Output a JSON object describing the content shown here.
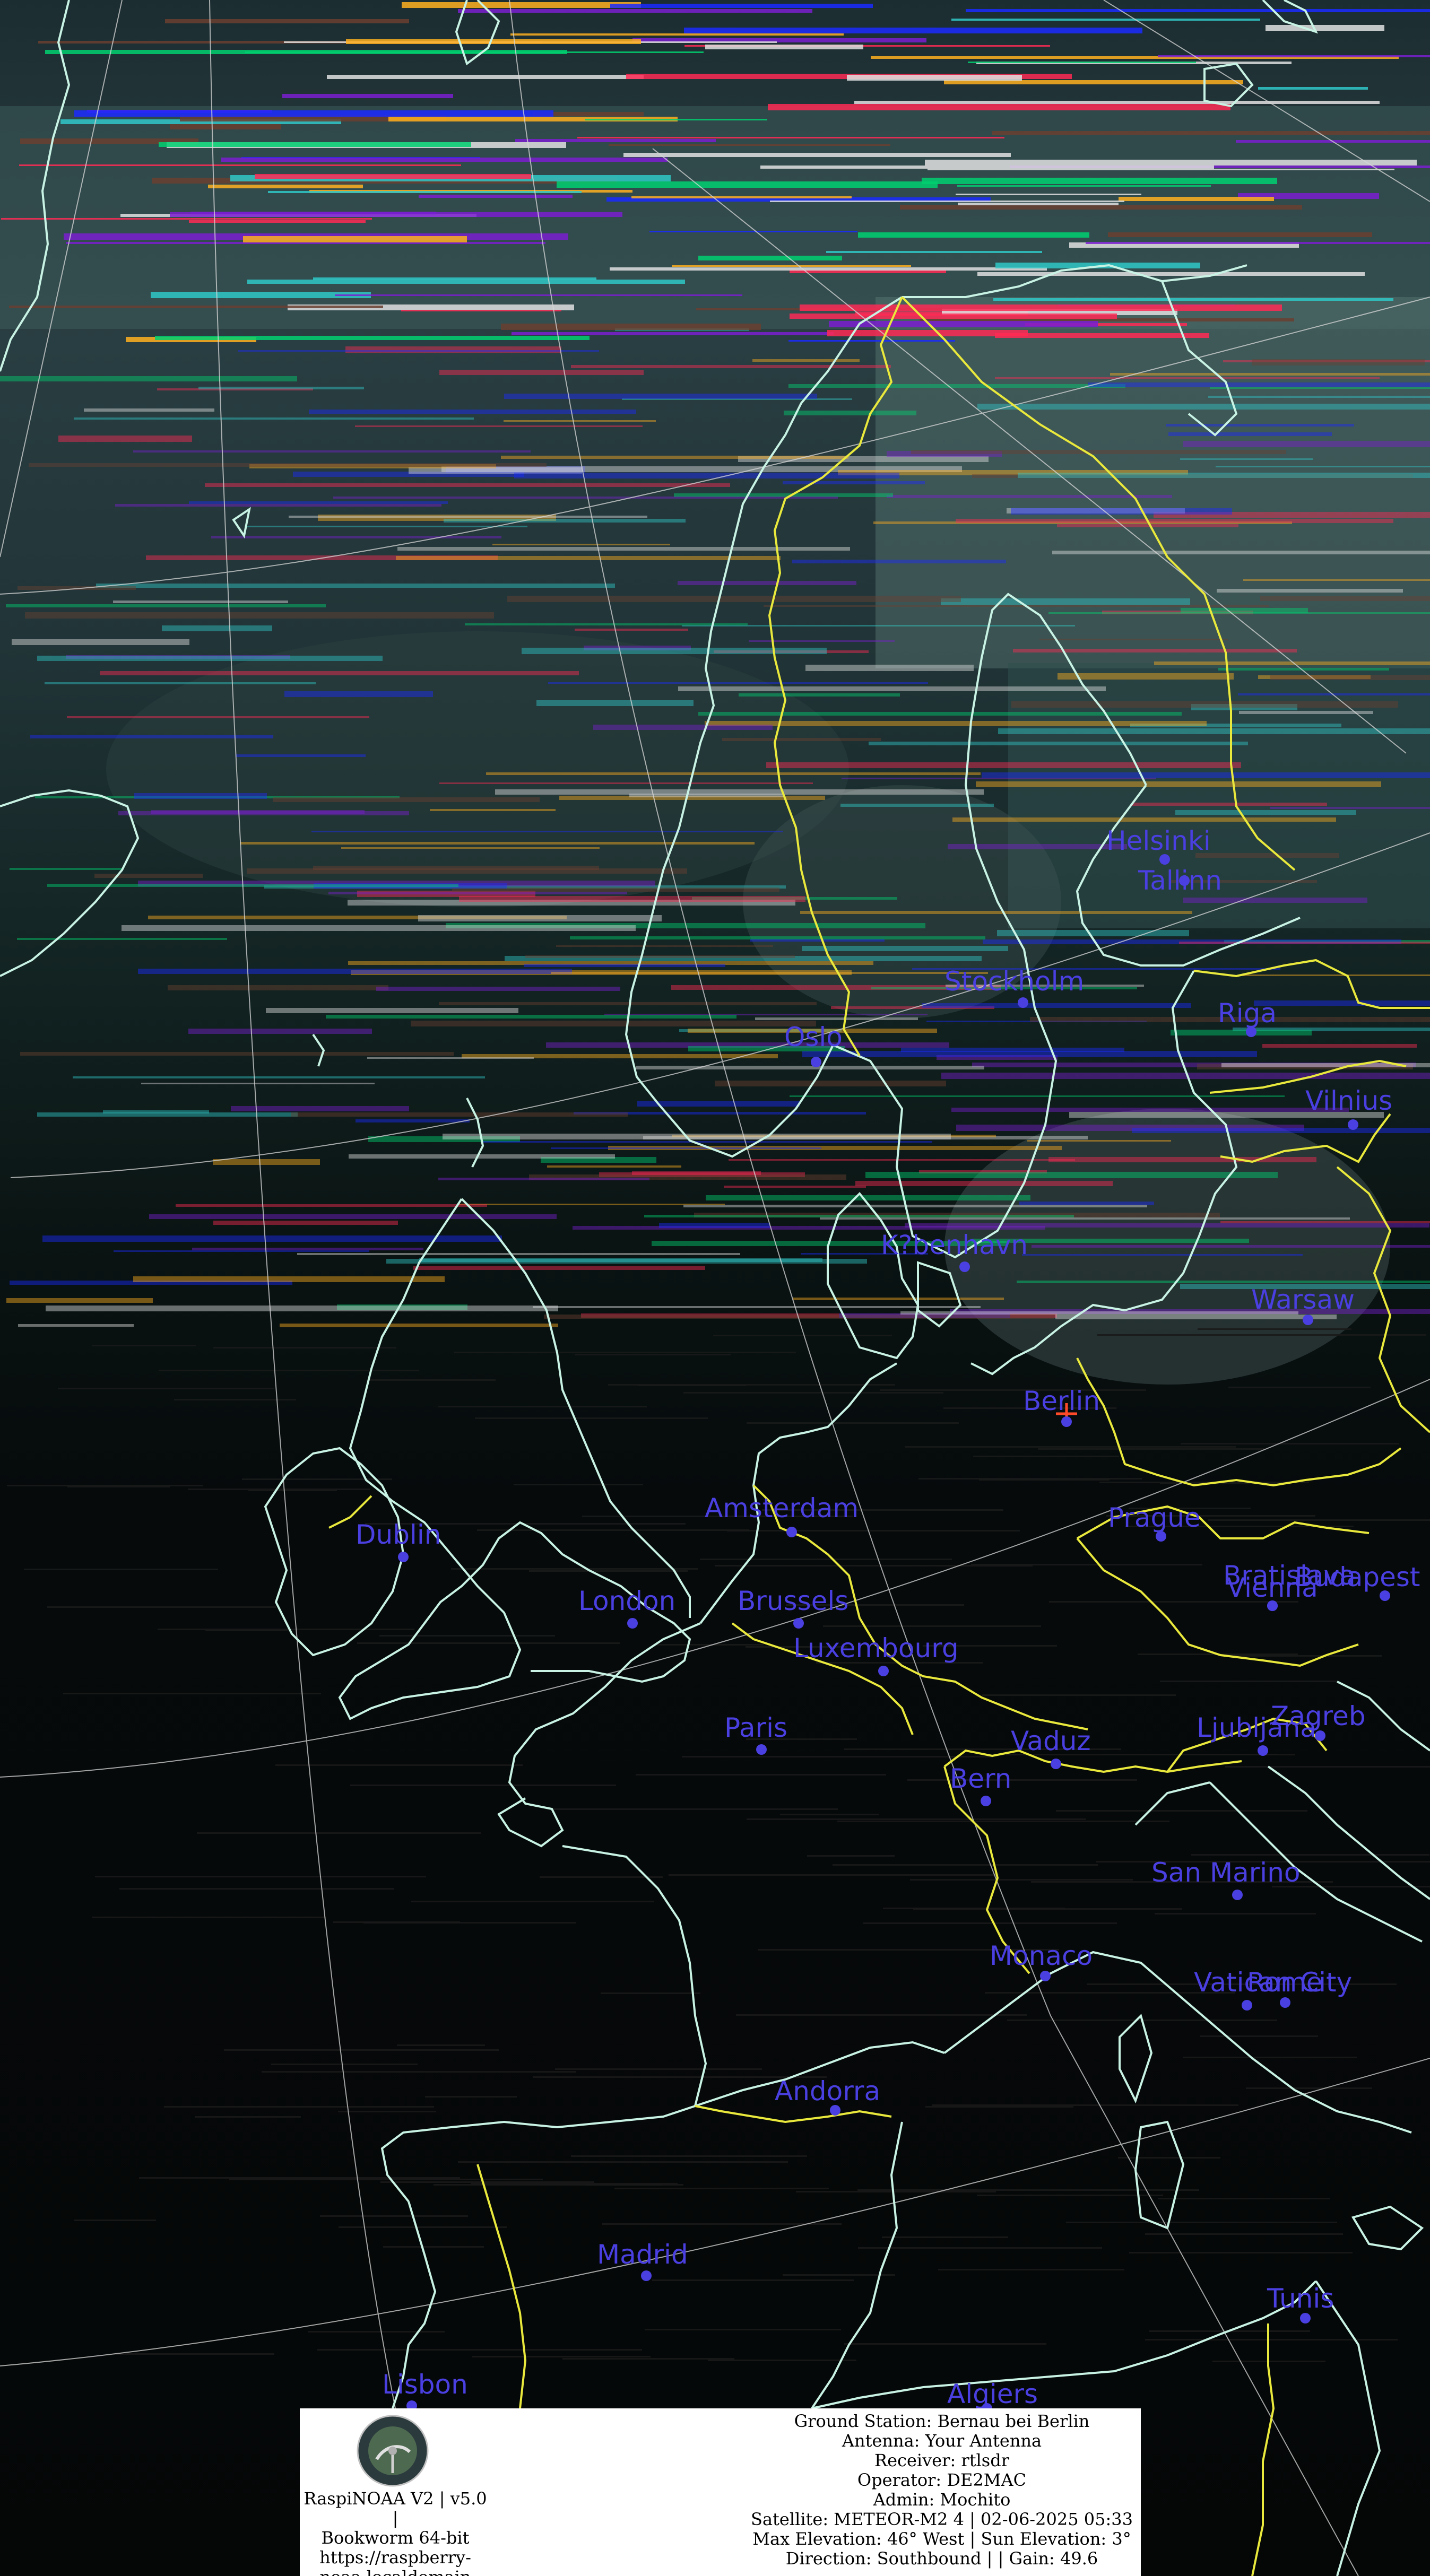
{
  "map": {
    "colors": {
      "coastline": "#c8f3e4",
      "border": "#e9e83c",
      "graticule": "#d8d8d8",
      "city": "#4a3fe0",
      "ground_station_marker": "#ff4a2a"
    },
    "cities": [
      {
        "name": "Helsinki"
      },
      {
        "name": "Tallinn"
      },
      {
        "name": "Stockholm"
      },
      {
        "name": "Oslo"
      },
      {
        "name": "Riga"
      },
      {
        "name": "Vilnius"
      },
      {
        "name": "K?benhavn"
      },
      {
        "name": "Warsaw"
      },
      {
        "name": "Berlin"
      },
      {
        "name": "Amsterdam"
      },
      {
        "name": "Dublin"
      },
      {
        "name": "London"
      },
      {
        "name": "Brussels"
      },
      {
        "name": "Prague"
      },
      {
        "name": "Bratislava"
      },
      {
        "name": "Vienna"
      },
      {
        "name": "Budapest"
      },
      {
        "name": "Luxembourg"
      },
      {
        "name": "Paris"
      },
      {
        "name": "Vaduz"
      },
      {
        "name": "Ljubljana"
      },
      {
        "name": "Zagreb"
      },
      {
        "name": "Bern"
      },
      {
        "name": "San Marino"
      },
      {
        "name": "Monaco"
      },
      {
        "name": "Vatican City"
      },
      {
        "name": "Rome"
      },
      {
        "name": "Andorra"
      },
      {
        "name": "Madrid"
      },
      {
        "name": "Tunis"
      },
      {
        "name": "Lisbon"
      },
      {
        "name": "Algiers"
      }
    ]
  },
  "info": {
    "logo_icon": "raspinoaa-satellite-dish-logo",
    "left_lines": [
      "RaspiNOAA V2 | v5.0 |",
      "Bookworm 64-bit",
      "https://raspberry-",
      "noaa.localdomain"
    ],
    "right_lines": [
      "Ground Station: Bernau bei Berlin",
      "Antenna: Your Antenna",
      "Receiver: rtlsdr",
      "Operator: DE2MAC",
      "Admin: Mochito",
      "Satellite: METEOR-M2 4 | 02-06-2025 05:33",
      "Max Elevation: 46° West | Sun Elevation: 3°",
      "Direction: Southbound | | Gain: 49.6"
    ]
  }
}
